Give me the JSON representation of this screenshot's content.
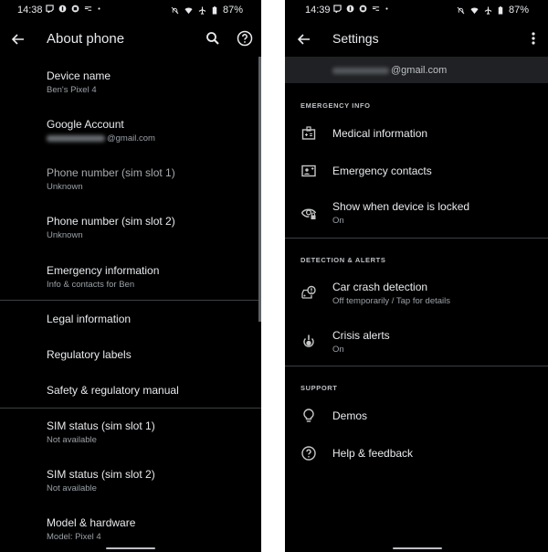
{
  "left_screen": {
    "status_bar": {
      "time": "14:38",
      "notification_icons": [
        "twitch-icon",
        "messenger-icon",
        "square-app-icon",
        "cast-icon",
        "dot-icon"
      ],
      "system_icons": [
        "bell-off-icon",
        "wifi-icon",
        "airplane-icon",
        "battery-icon"
      ],
      "battery": "87%"
    },
    "app_bar": {
      "title": "About phone",
      "back_icon": "arrow-back-icon",
      "actions": [
        "search-icon",
        "help-icon"
      ]
    },
    "items": [
      {
        "title": "Device name",
        "subtitle": "Ben's Pixel 4"
      },
      {
        "title": "Google Account",
        "subtitle_blurred": true,
        "subtitle": "@gmail.com"
      },
      {
        "title": "Phone number (sim slot 1)",
        "subtitle": "Unknown",
        "disabled": true
      },
      {
        "title": "Phone number (sim slot 2)",
        "subtitle": "Unknown"
      },
      {
        "title": "Emergency information",
        "subtitle": "Info & contacts for Ben"
      },
      {
        "title": "Legal information"
      },
      {
        "title": "Regulatory labels"
      },
      {
        "title": "Safety & regulatory manual"
      },
      {
        "title": "SIM status (sim slot 1)",
        "subtitle": "Not available"
      },
      {
        "title": "SIM status (sim slot 2)",
        "subtitle": "Not available"
      },
      {
        "title": "Model & hardware",
        "subtitle": "Model: Pixel 4"
      }
    ]
  },
  "right_screen": {
    "status_bar": {
      "time": "14:39",
      "notification_icons": [
        "twitch-icon",
        "messenger-icon",
        "square-app-icon",
        "cast-icon",
        "dot-icon"
      ],
      "system_icons": [
        "bell-off-icon",
        "wifi-icon",
        "airplane-icon",
        "battery-icon"
      ],
      "battery": "87%"
    },
    "app_bar": {
      "title": "Settings",
      "back_icon": "arrow-back-icon",
      "actions": [
        "more-vert-icon"
      ]
    },
    "account": {
      "email_suffix": "@gmail.com",
      "blurred_prefix": true
    },
    "sections": [
      {
        "header": "EMERGENCY INFO",
        "items": [
          {
            "icon": "medical-id-icon",
            "title": "Medical information"
          },
          {
            "icon": "contact-card-icon",
            "title": "Emergency contacts"
          },
          {
            "icon": "eye-lock-icon",
            "title": "Show when device is locked",
            "subtitle": "On"
          }
        ]
      },
      {
        "header": "DETECTION & ALERTS",
        "items": [
          {
            "icon": "car-crash-icon",
            "title": "Car crash detection",
            "subtitle": "Off temporarily / Tap for details"
          },
          {
            "icon": "crisis-alert-icon",
            "title": "Crisis alerts",
            "subtitle": "On"
          }
        ]
      },
      {
        "header": "SUPPORT",
        "items": [
          {
            "icon": "lightbulb-icon",
            "title": "Demos"
          },
          {
            "icon": "help-icon",
            "title": "Help & feedback"
          }
        ]
      }
    ]
  }
}
